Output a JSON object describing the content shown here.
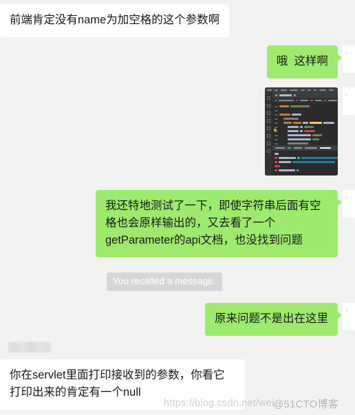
{
  "app": {
    "name": "WeChat chat transcript",
    "background_color": "#f2f2f2",
    "outgoing_bubble_color": "#9eea6f",
    "incoming_bubble_color": "#ffffff",
    "system_pill_color": "#d6d6d6"
  },
  "messages": [
    {
      "id": "msg-1",
      "side": "incoming",
      "type": "text",
      "text": "前端肯定没有name为加空格的这个参数啊"
    },
    {
      "id": "msg-2",
      "side": "outgoing",
      "type": "text",
      "text": "哦  这样啊"
    },
    {
      "id": "msg-3",
      "side": "outgoing",
      "type": "image",
      "alt": "IDE code editor screenshot with console output"
    },
    {
      "id": "msg-4",
      "side": "outgoing",
      "type": "text",
      "text": "我还特地测试了一下，即使字符串后面有空格也会原样输出的，又去看了一个getParameter的api文档，也没找到问题"
    },
    {
      "id": "msg-5",
      "side": "system",
      "type": "notice",
      "text": "You recalled a message."
    },
    {
      "id": "msg-6",
      "side": "outgoing",
      "type": "text",
      "text": "原来问题不是出在这里"
    },
    {
      "id": "msg-7",
      "side": "incoming",
      "type": "text",
      "sender_name_redacted": true,
      "text": "你在servlet里面打印接收到的参数，你看它打印出来的肯定有一个null"
    }
  ],
  "avatar": {
    "glyph": "⌗"
  },
  "watermarks": {
    "csdn": "https://blog.csdn.net/wei",
    "cto": "@51CTO博客"
  }
}
